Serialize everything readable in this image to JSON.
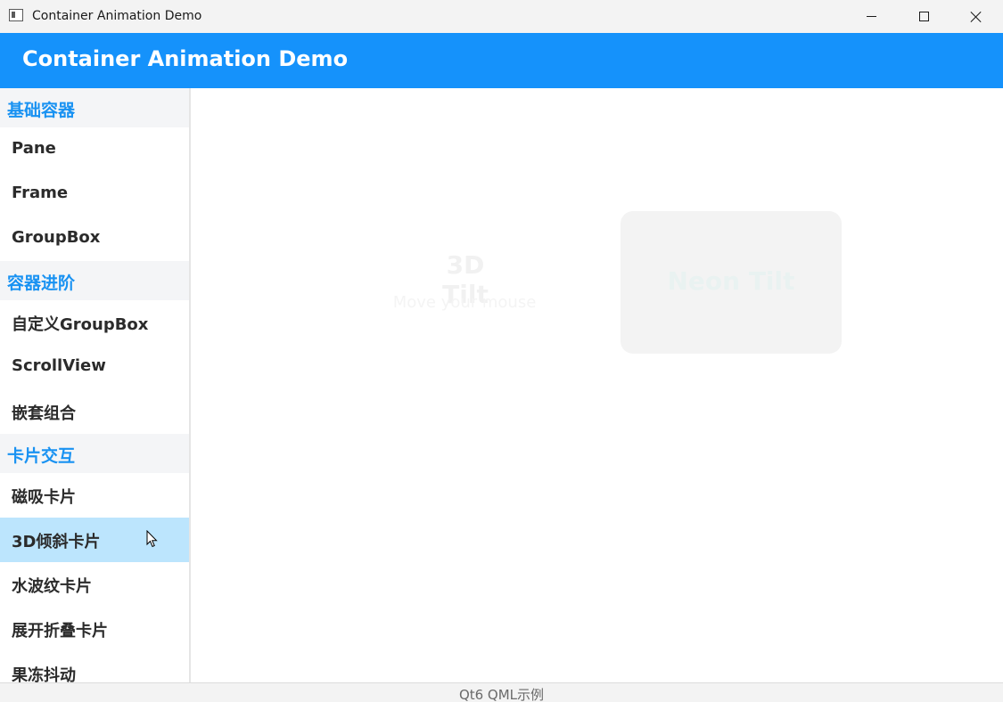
{
  "window": {
    "title": "Container Animation Demo",
    "icon": "app-window-icon",
    "controls": [
      "minimize-icon",
      "maximize-icon",
      "close-icon"
    ]
  },
  "header": {
    "title": "Container Animation Demo",
    "color": "#1592fb"
  },
  "sidebar": {
    "sections": [
      {
        "label": "基础容器",
        "items": [
          "Pane",
          "Frame",
          "GroupBox"
        ]
      },
      {
        "label": "容器进阶",
        "items": [
          "自定义GroupBox",
          "ScrollView",
          "嵌套组合"
        ]
      },
      {
        "label": "卡片交互",
        "items": [
          "磁吸卡片",
          "3D倾斜卡片",
          "水波纹卡片",
          "展开折叠卡片",
          "果冻抖动"
        ]
      }
    ],
    "selected": "3D倾斜卡片",
    "accent_color": "#1992f2",
    "selected_color": "#bce5fd"
  },
  "main": {
    "tilt_card": {
      "title": "3D Tilt",
      "subtitle": "Move your mouse"
    },
    "neon_card": {
      "title": "Neon Tilt"
    }
  },
  "status": {
    "text": "Qt6 QML示例"
  }
}
